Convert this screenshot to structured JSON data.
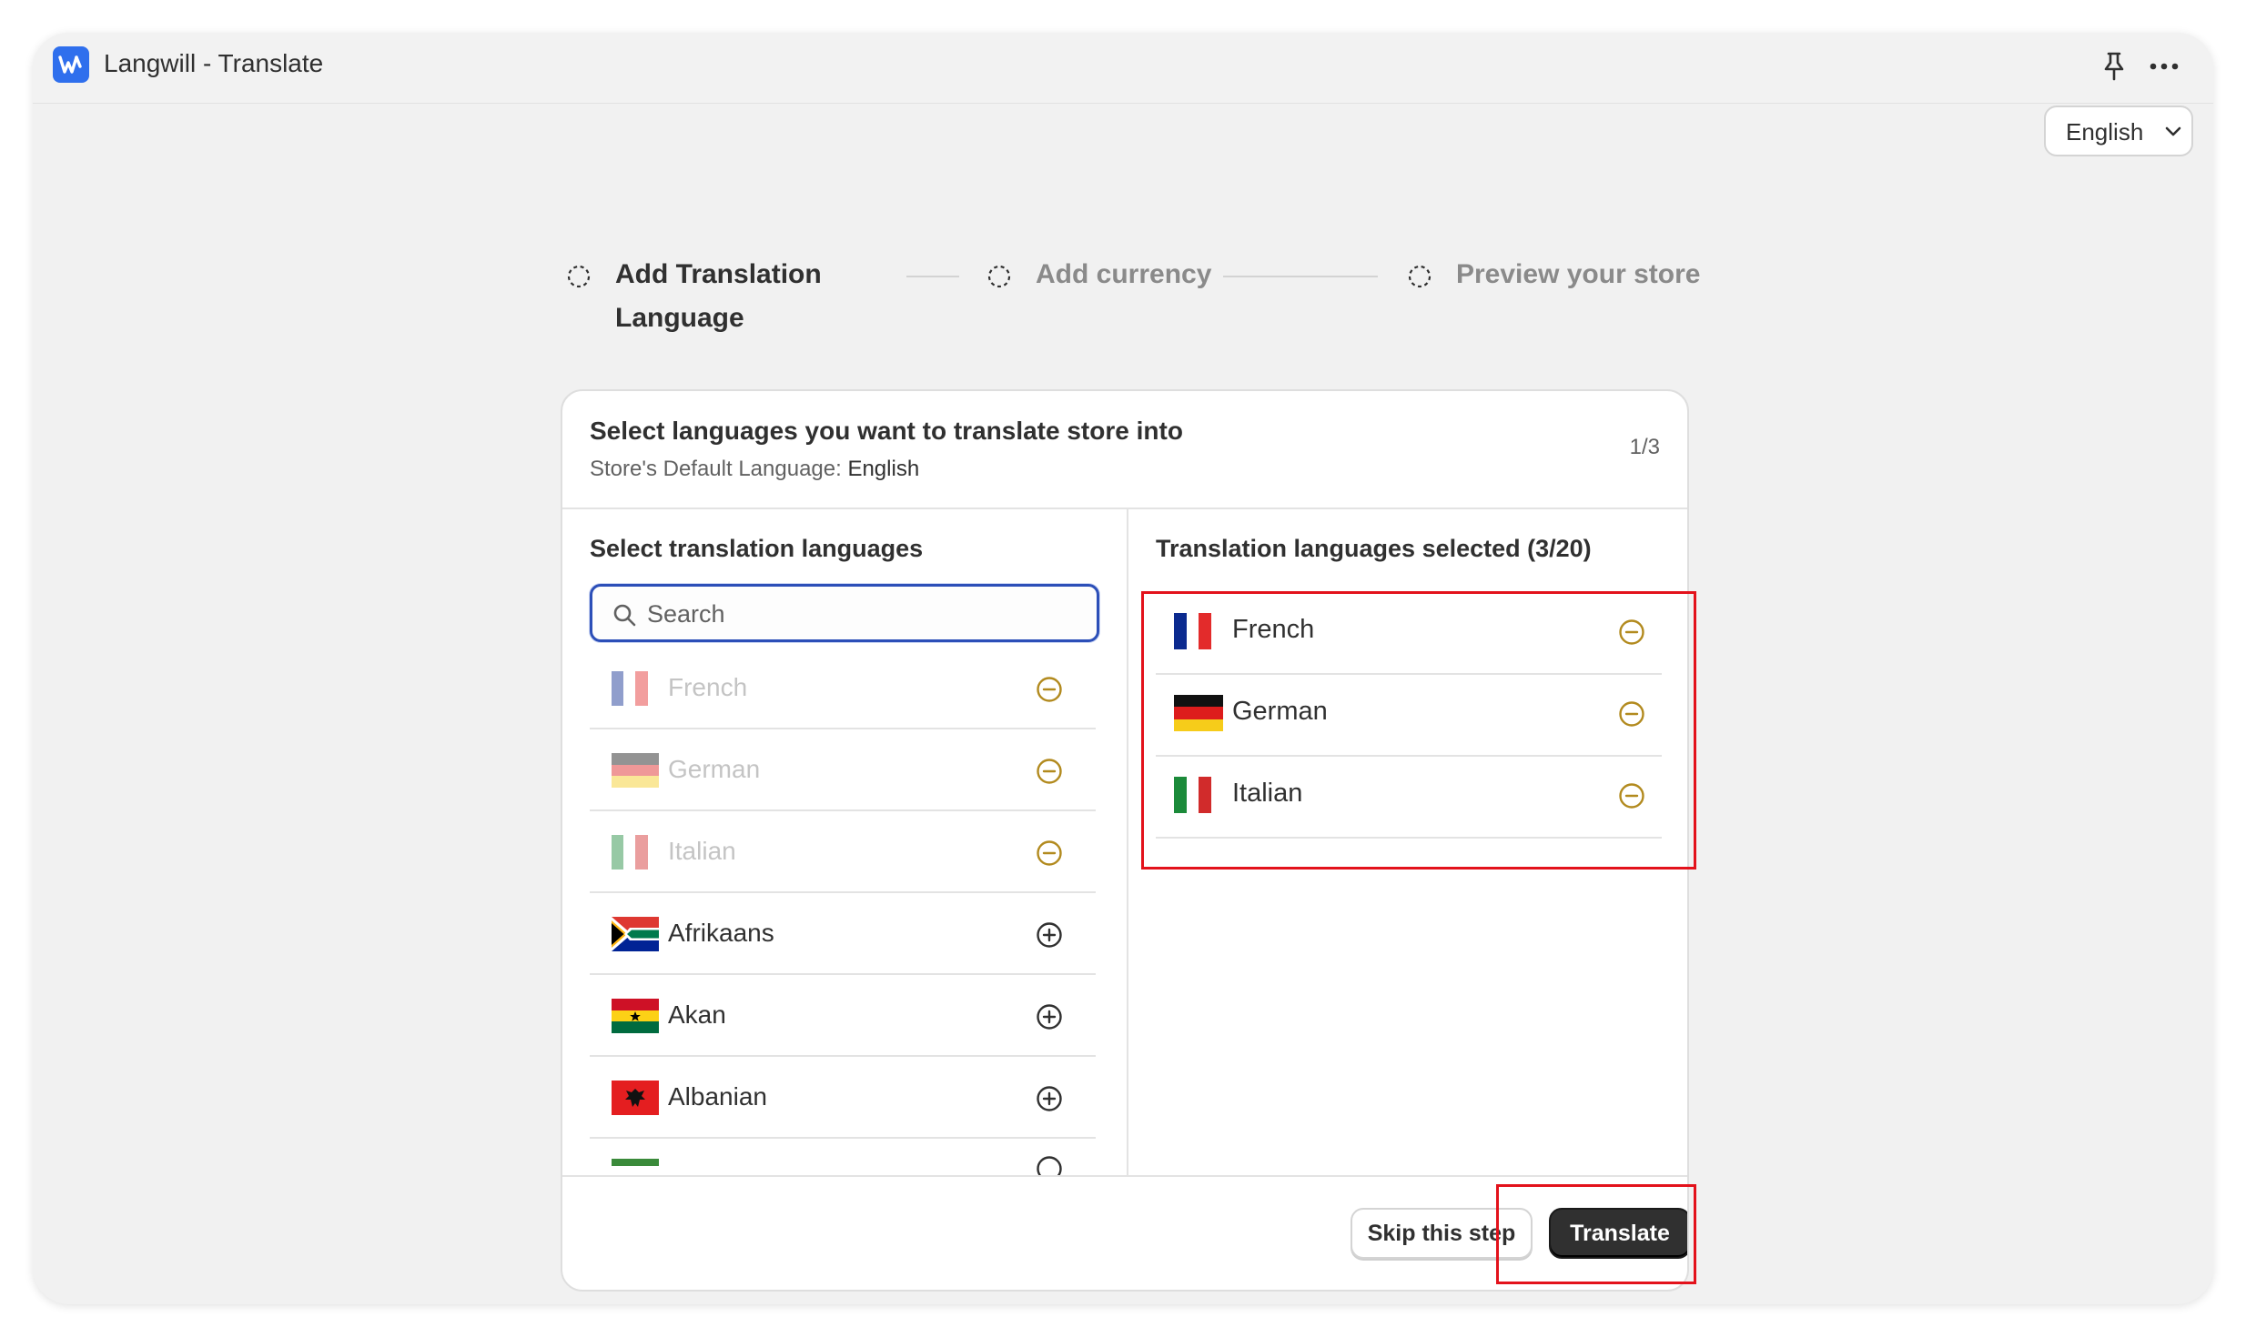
{
  "app": {
    "title": "Langwill - Translate",
    "logo_icon": "langwill-w-logo",
    "accent": "#2f6fed"
  },
  "header": {
    "language_selector": {
      "value": "English"
    }
  },
  "stepper": {
    "steps": [
      {
        "label": "Add Translation Language",
        "label_line1": "Add Translation",
        "label_line2": "Language",
        "state": "active"
      },
      {
        "label": "Add currency",
        "state": "pending"
      },
      {
        "label": "Preview your store",
        "state": "pending"
      }
    ]
  },
  "card": {
    "title": "Select languages you want to translate store into",
    "default_language_label": "Store's Default Language:",
    "default_language_value": "English",
    "page_indicator": "1/3",
    "left": {
      "title": "Select translation languages",
      "search_placeholder": "Search",
      "search_value": "",
      "languages": [
        {
          "name": "French",
          "flag": "fr",
          "selected": true
        },
        {
          "name": "German",
          "flag": "de",
          "selected": true
        },
        {
          "name": "Italian",
          "flag": "it",
          "selected": true
        },
        {
          "name": "Afrikaans",
          "flag": "za",
          "selected": false
        },
        {
          "name": "Akan",
          "flag": "gh",
          "selected": false
        },
        {
          "name": "Albanian",
          "flag": "al",
          "selected": false
        },
        {
          "name": "",
          "flag": "partial",
          "selected": false
        }
      ]
    },
    "right": {
      "title": "Translation languages selected (3/20)",
      "selected": [
        {
          "name": "French",
          "flag": "fr"
        },
        {
          "name": "German",
          "flag": "de"
        },
        {
          "name": "Italian",
          "flag": "it"
        }
      ]
    },
    "footer": {
      "skip_label": "Skip this step",
      "translate_label": "Translate"
    }
  },
  "colors": {
    "remove_icon": "#b28a1e",
    "add_icon": "#303030",
    "highlight": "#e3121b",
    "primary_button": "#303030",
    "search_focus": "#2c4fb8"
  }
}
